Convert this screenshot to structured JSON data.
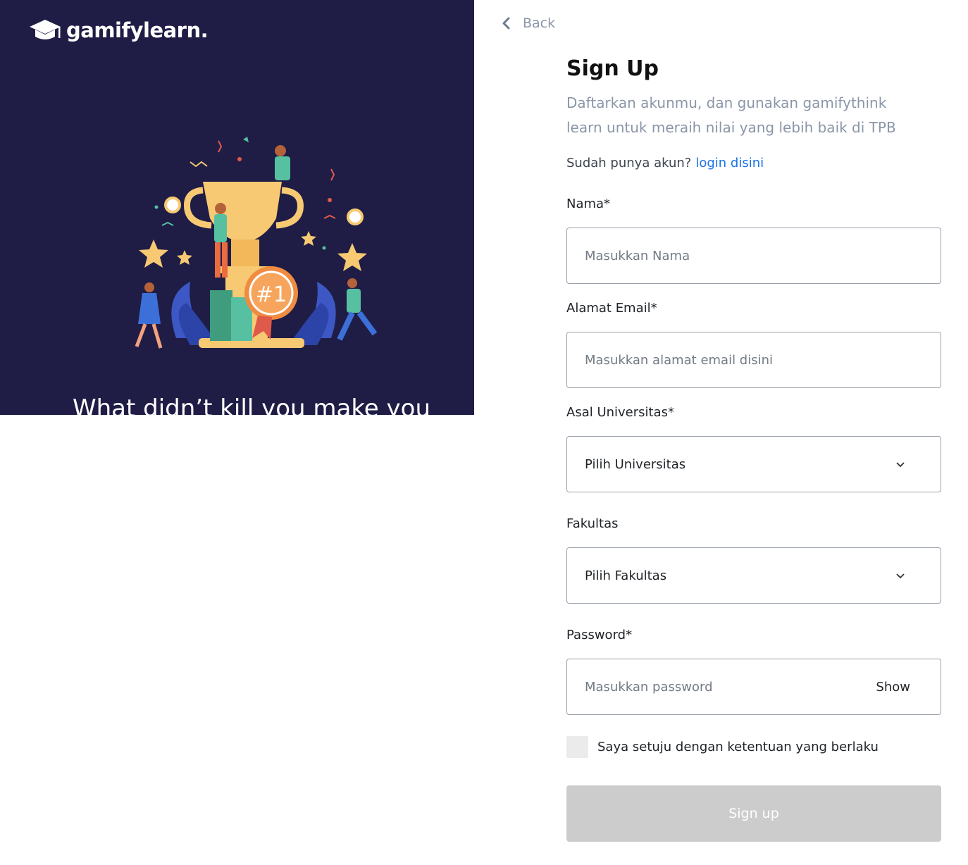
{
  "brand": {
    "name": "gamifylearn.",
    "logo_icon": "graduation-cap-icon"
  },
  "left": {
    "tagline": "What didn’t kill you make you",
    "badge": "#1"
  },
  "nav": {
    "back_label": "Back",
    "back_icon": "chevron-left-icon"
  },
  "form": {
    "title": "Sign Up",
    "subtitle": "Daftarkan akunmu, dan gunakan gamifythink learn untuk meraih nilai yang lebih baik di TPB",
    "login_prompt": "Sudah punya akun?",
    "login_link": "login disini",
    "name_label": "Nama*",
    "name_placeholder": "Masukkan Nama",
    "email_label": "Alamat Email*",
    "email_placeholder": "Masukkan alamat email disini",
    "university_label": "Asal Universitas*",
    "university_value": "Pilih Universitas",
    "faculty_label": "Fakultas",
    "faculty_value": "Pilih Fakultas",
    "password_label": "Password*",
    "password_placeholder": "Masukkan password",
    "show_label": "Show",
    "agree_label": "Saya setuju dengan ketentuan yang berlaku",
    "submit_label": "Sign up"
  },
  "colors": {
    "panel_bg": "#1f1d46",
    "link": "#1a73e8",
    "muted": "#8a96a8",
    "button_disabled": "#cccccc"
  }
}
